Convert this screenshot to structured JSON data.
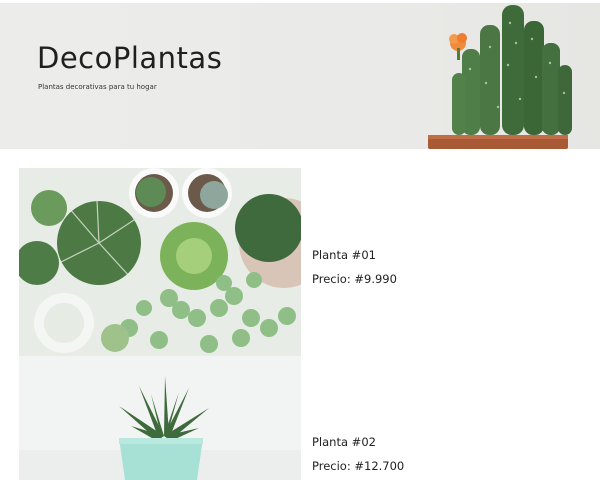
{
  "hero": {
    "title": "DecoPlantas",
    "subtitle": "Plantas decorativas para tu hogar"
  },
  "products": [
    {
      "name": "Planta #01",
      "price": "Precio: #9.990",
      "image": "succulents-arrangement-image"
    },
    {
      "name": "Planta #02",
      "price": "Precio: #12.700",
      "image": "potted-succulent-image"
    }
  ]
}
